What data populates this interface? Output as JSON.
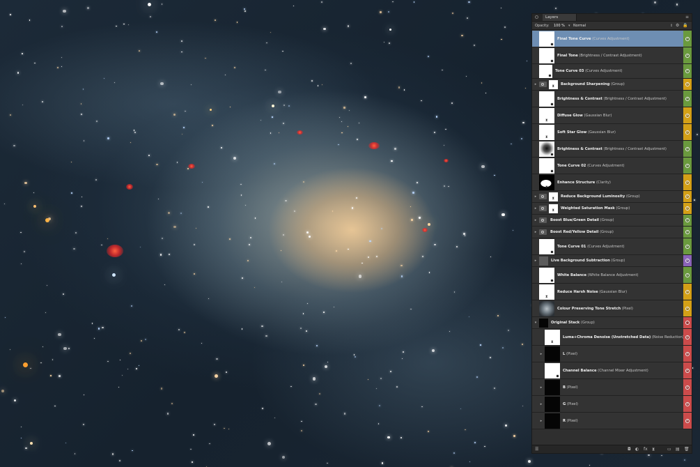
{
  "panel": {
    "tab_label": "Layers",
    "opacity_label": "Opacity:",
    "opacity_value": "100 %",
    "blend_mode": "Normal"
  },
  "layers": [
    {
      "name": "Final Tone Curve",
      "type": "(Curves Adjustment)",
      "thumb": "white",
      "badge": true,
      "tag": "#6a9a3e",
      "selected": true,
      "indent": 0,
      "expander": false,
      "folder": false,
      "visible": true
    },
    {
      "name": "Final Tone",
      "type": "(Brightness / Contrast Adjustment)",
      "thumb": "white",
      "badge": true,
      "tag": "#6a9a3e",
      "indent": 0,
      "expander": false,
      "folder": false,
      "visible": true
    },
    {
      "name": "Tone Curve 03",
      "type": "(Curves Adjustment)",
      "thumb": "white",
      "badge": true,
      "tag": "#6a9a3e",
      "indent": 0,
      "expander": false,
      "folder": false,
      "visible": true
    },
    {
      "name": "Background Sharpening",
      "type": "(Group)",
      "thumb": "white-small",
      "hourglass": true,
      "tag": "#d4a017",
      "indent": 0,
      "expander": true,
      "folder": true,
      "visible": true
    },
    {
      "name": "Brightness & Contrast",
      "type": "(Brightness / Contrast Adjustment)",
      "thumb": "white",
      "badge": true,
      "tag": "#6a9a3e",
      "indent": 0,
      "expander": false,
      "folder": false,
      "visible": true
    },
    {
      "name": "Diffuse Glow",
      "type": "(Gaussian Blur)",
      "thumb": "white",
      "hourglass": true,
      "tag": "#d4a017",
      "indent": 0,
      "expander": false,
      "folder": false,
      "visible": true
    },
    {
      "name": "Soft Star Glow",
      "type": "(Gaussian Blur)",
      "thumb": "white",
      "hourglass": true,
      "tag": "#d4a017",
      "indent": 0,
      "expander": false,
      "folder": false,
      "visible": true
    },
    {
      "name": "Brightness & Contrast",
      "type": "(Brightness / Contrast Adjustment)",
      "thumb": "blur",
      "badge": true,
      "tag": "#6a9a3e",
      "indent": 0,
      "expander": false,
      "folder": false,
      "visible": true
    },
    {
      "name": "Tone Curve 02",
      "type": "(Curves Adjustment)",
      "thumb": "white",
      "badge": true,
      "tag": "#6a9a3e",
      "indent": 0,
      "expander": false,
      "folder": false,
      "visible": true
    },
    {
      "name": "Enhance Structure",
      "type": "(Clarity)",
      "thumb": "clarity",
      "hourglass": true,
      "tag": "#d4a017",
      "indent": 0,
      "expander": false,
      "folder": false,
      "visible": true
    },
    {
      "name": "Reduce Background Luminosity",
      "type": "(Group)",
      "thumb": "white-small",
      "hourglass": true,
      "tag": "#d4a017",
      "indent": 0,
      "expander": true,
      "folder": true,
      "visible": true
    },
    {
      "name": "Weighted Saturation Mask",
      "type": "(Group)",
      "thumb": "white-small",
      "hourglass": true,
      "tag": "#d4a017",
      "indent": 0,
      "expander": true,
      "folder": true,
      "visible": true
    },
    {
      "name": "Boost Blue/Green Detail",
      "type": "(Group)",
      "thumb": "none",
      "tag": "#6a9a3e",
      "indent": 0,
      "expander": true,
      "folder": true,
      "visible": true
    },
    {
      "name": "Boost Red/Yellow Detail",
      "type": "(Group)",
      "thumb": "none",
      "tag": "#6a9a3e",
      "indent": 0,
      "expander": true,
      "folder": true,
      "visible": true
    },
    {
      "name": "Tone Curve 01",
      "type": "(Curves Adjustment)",
      "thumb": "white",
      "badge": true,
      "tag": "#6a9a3e",
      "indent": 0,
      "expander": false,
      "folder": false,
      "visible": true
    },
    {
      "name": "Live Background Subtraction",
      "type": "(Group)",
      "thumb": "grey-small",
      "tag": "#8a63b8",
      "indent": 0,
      "expander": true,
      "folder": false,
      "visible": true
    },
    {
      "name": "White Balance",
      "type": "(White Balance Adjustment)",
      "thumb": "white",
      "badge": true,
      "tag": "#6a9a3e",
      "indent": 0,
      "expander": false,
      "folder": false,
      "visible": true
    },
    {
      "name": "Reduce Harsh Noise",
      "type": "(Gaussian Blur)",
      "thumb": "white",
      "hourglass": true,
      "tag": "#d4a017",
      "indent": 0,
      "expander": false,
      "folder": false,
      "visible": true
    },
    {
      "name": "Colour Preserving Tone Stretch",
      "type": "(Pixel)",
      "thumb": "nebula",
      "tag": "#d4a017",
      "indent": 0,
      "expander": false,
      "folder": false,
      "visible": true
    },
    {
      "name": "Original Stack",
      "type": "(Group)",
      "thumb": "dark-small",
      "tag": "#cc4b4b",
      "indent": 0,
      "expander": true,
      "expanded": true,
      "folder": false,
      "visible": false
    },
    {
      "name": "Luma+Chroma Denoise (Unstretched Data)",
      "type": "(Noise Reduction)",
      "thumb": "white",
      "hourglass": true,
      "tag": "#cc4b4b",
      "indent": 1,
      "expander": false,
      "folder": false,
      "visible": true
    },
    {
      "name": "L",
      "type": "(Pixel)",
      "thumb": "dark",
      "tag": "#cc4b4b",
      "indent": 1,
      "expander": true,
      "folder": false,
      "visible": true
    },
    {
      "name": "Channel Balance",
      "type": "(Channel Mixer Adjustment)",
      "thumb": "white",
      "badge": true,
      "tag": "#cc4b4b",
      "indent": 1,
      "expander": false,
      "folder": false,
      "visible": true
    },
    {
      "name": "B",
      "type": "(Pixel)",
      "thumb": "dark",
      "tag": "#cc4b4b",
      "indent": 1,
      "expander": true,
      "folder": false,
      "visible": true
    },
    {
      "name": "G",
      "type": "(Pixel)",
      "thumb": "dark",
      "tag": "#cc4b4b",
      "indent": 1,
      "expander": true,
      "folder": false,
      "visible": true
    },
    {
      "name": "R",
      "type": "(Pixel)",
      "thumb": "dark",
      "tag": "#cc4b4b",
      "indent": 1,
      "expander": true,
      "folder": false,
      "visible": true
    }
  ],
  "bottom_icons": [
    "layers-stack-icon",
    "mask-icon",
    "adjustment-icon",
    "fx-icon",
    "live-filter-icon",
    "folder-icon",
    "add-layer-icon",
    "trash-icon"
  ],
  "colors": {
    "selected": "#6e8eb3",
    "green": "#6a9a3e",
    "yellow": "#d4a017",
    "purple": "#8a63b8",
    "red": "#cc4b4b"
  }
}
